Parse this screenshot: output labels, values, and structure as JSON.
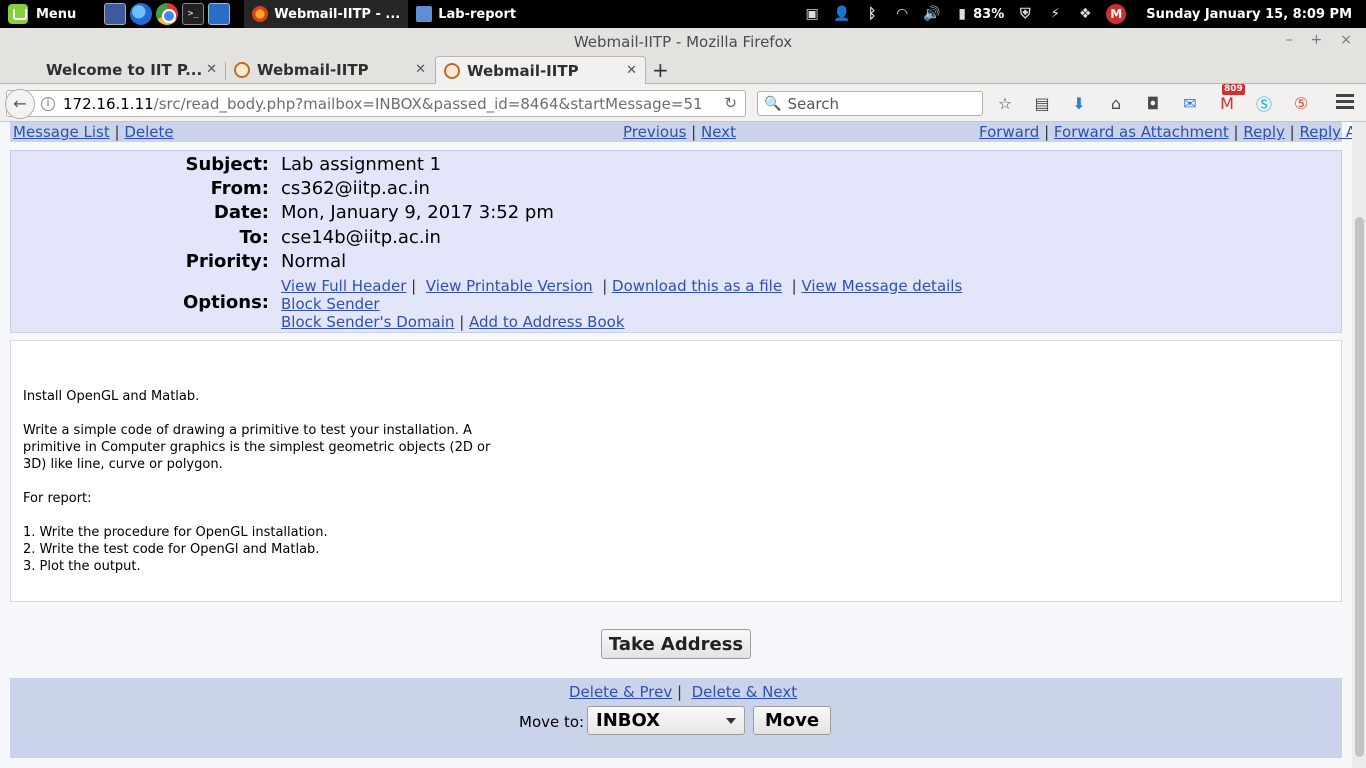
{
  "panel": {
    "menu_label": "Menu",
    "tasks": [
      {
        "label": "Webmail-IITP - ..."
      },
      {
        "label": "Lab-report"
      }
    ],
    "battery": "83%",
    "clock": "Sunday January 15,  8:09 PM",
    "terminal_glyph": ">_",
    "tray_m": "M"
  },
  "browser": {
    "window_title": "Webmail-IITP - Mozilla Firefox",
    "tabs": [
      {
        "label": "Welcome to IIT P..."
      },
      {
        "label": "Webmail-IITP"
      },
      {
        "label": "Webmail-IITP"
      }
    ],
    "url_host": "172.16.1.11",
    "url_path": "/src/read_body.php?mailbox=INBOX&passed_id=8464&startMessage=51",
    "search_placeholder": "Search",
    "mail_badge": "809"
  },
  "topnav": {
    "message_list": "Message List",
    "delete": "Delete",
    "previous": "Previous",
    "next": "Next",
    "forward": "Forward",
    "forward_attachment": "Forward as Attachment",
    "reply": "Reply",
    "reply_all": "Reply All"
  },
  "header": {
    "subject_label": "Subject:",
    "subject": "Lab assignment 1",
    "from_label": "From:",
    "from": "cs362@iitp.ac.in",
    "date_label": "Date:",
    "date": "Mon, January 9, 2017 3:52 pm",
    "to_label": "To:",
    "to": "cse14b@iitp.ac.in",
    "priority_label": "Priority:",
    "priority": "Normal",
    "options_label": "Options:",
    "options": {
      "view_full_header": "View Full Header",
      "view_printable": "View Printable Version",
      "download": "Download this as a file",
      "view_details": "View Message details",
      "block_sender": "Block Sender",
      "block_domain": "Block Sender's Domain",
      "add_address": "Add to Address Book"
    }
  },
  "body": {
    "lines": [
      "Install OpenGL and Matlab.",
      "Write a simple code of drawing a primitive to test your installation. A",
      "primitive in Computer graphics is the simplest geometric objects (2D or",
      "3D) like line, curve or polygon.",
      "For report:",
      "1. Write the procedure for OpenGL installation.",
      "2. Write the test code for OpenGl and Matlab.",
      "3. Plot the output."
    ]
  },
  "actions": {
    "take_address": "Take Address",
    "delete_prev": "Delete & Prev",
    "delete_next": "Delete & Next",
    "move_to_label": "Move to:",
    "folder_selected": "INBOX",
    "move_button": "Move"
  }
}
